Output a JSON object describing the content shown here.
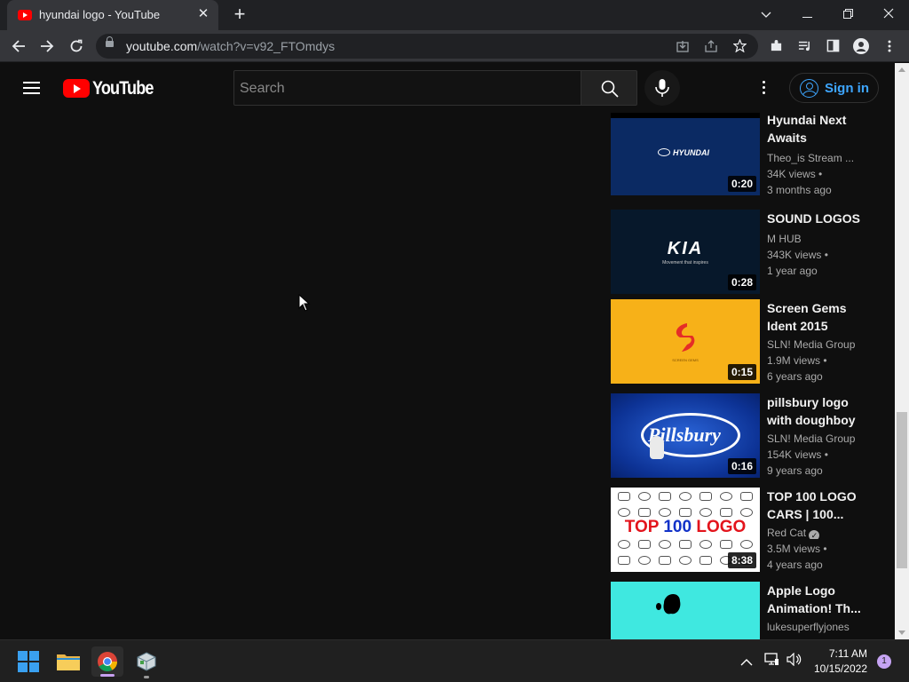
{
  "browser": {
    "tab_title": "hyundai logo - YouTube",
    "url_domain": "youtube.com",
    "url_path": "/watch?v=v92_FTOmdys"
  },
  "youtube": {
    "logo_text": "YouTube",
    "search_placeholder": "Search",
    "signin_label": "Sign in"
  },
  "recommendations": [
    {
      "title": "Hyundai Next Awaits",
      "channel": "Theo_is Stream ...",
      "views": "34K views •",
      "age": "3 months ago",
      "duration": "0:20",
      "thumb_text": "HYUNDAI",
      "thumb_bg": "#0b2a63"
    },
    {
      "title": "SOUND LOGOS",
      "channel": "M HUB",
      "views": "343K views •",
      "age": "1 year ago",
      "duration": "0:28",
      "thumb_text": "KIA",
      "thumb_subtext": "Movement that inspires",
      "thumb_bg": "#07182b"
    },
    {
      "title": "Screen Gems Ident 2015",
      "channel": "SLN! Media Group",
      "views": "1.9M views •",
      "age": "6 years ago",
      "duration": "0:15",
      "thumb_text": "SCREEN GEMS",
      "thumb_bg": "#f7b118"
    },
    {
      "title": "pillsbury logo with doughboy",
      "channel": "SLN! Media Group",
      "views": "154K views •",
      "age": "9 years ago",
      "duration": "0:16",
      "thumb_text": "Pillsbury",
      "thumb_bg": "#1443a8"
    },
    {
      "title": "TOP 100 LOGO CARS | 100...",
      "channel": "Red Cat",
      "verified": true,
      "views": "3.5M views •",
      "age": "4 years ago",
      "duration": "8:38",
      "thumb_text_a": "TOP ",
      "thumb_text_b": "100",
      "thumb_text_c": " LOGO",
      "thumb_bg": "#ffffff"
    },
    {
      "title": "Apple Logo Animation! Th...",
      "channel": "lukesuperflyjones",
      "thumb_bg": "#3fe8e0"
    }
  ],
  "taskbar": {
    "time": "7:11 AM",
    "date": "10/15/2022",
    "notification_count": "1"
  },
  "colors": {
    "yt_red": "#ff0000",
    "yt_bg": "#0f0f0f",
    "link_blue": "#3ea6ff",
    "chrome_dark": "#202124"
  }
}
